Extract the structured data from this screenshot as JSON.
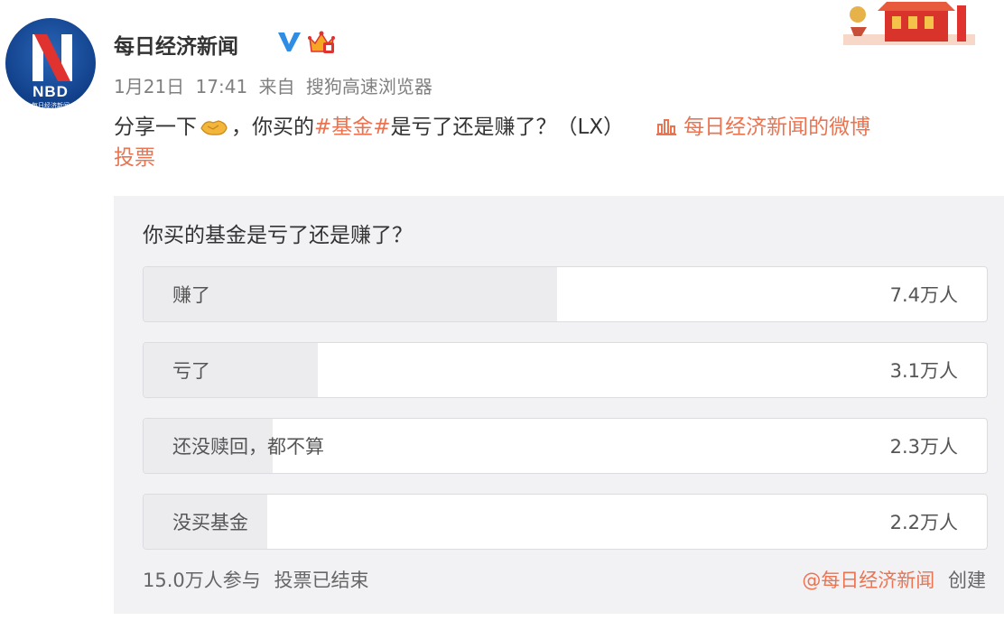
{
  "user": {
    "name": "每日经济新闻",
    "avatar_text": "NBD",
    "avatar_subtext": "每日经济新闻"
  },
  "meta": {
    "date": "1月21日",
    "time": "17:41",
    "from": "来自",
    "source": "搜狗高速浏览器"
  },
  "post": {
    "prefix": "分享一下",
    "middle": "，你买的",
    "hashtag": "#基金#",
    "suffix": "是亏了还是赚了？（LX）",
    "source_link": "每日经济新闻的微博",
    "vote_link": "投票"
  },
  "poll": {
    "question": "你买的基金是亏了还是赚了？",
    "options": [
      {
        "label": "赚了",
        "count": "7.4万人",
        "share": 0.49
      },
      {
        "label": "亏了",
        "count": "3.1万人",
        "share": 0.207
      },
      {
        "label": "还没赎回，都不算",
        "count": "2.3万人",
        "share": 0.153
      },
      {
        "label": "没买基金",
        "count": "2.2万人",
        "share": 0.147
      }
    ],
    "participants": "15.0万人参与",
    "status": "投票已结束",
    "creator": "@每日经济新闻",
    "creator_suffix": "创建"
  },
  "colors": {
    "link": "#eb7350",
    "poll_bg": "#f2f2f5",
    "bar_fill": "#ececef",
    "verified": "#2f8de4"
  }
}
